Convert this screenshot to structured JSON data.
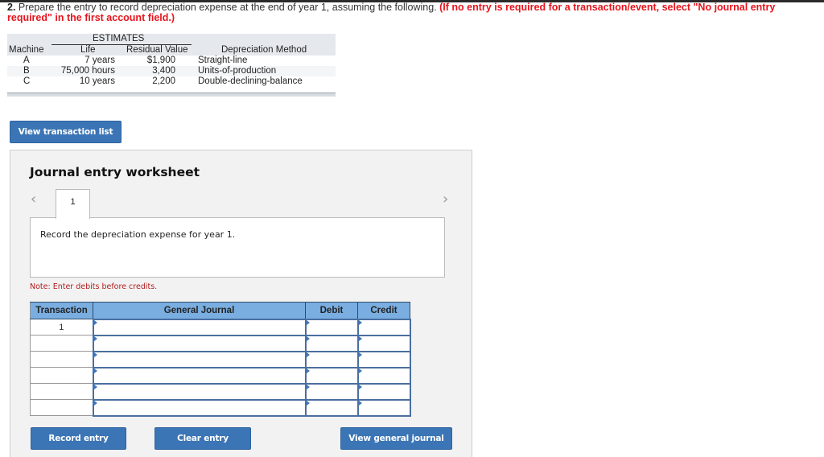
{
  "question": {
    "number": "2.",
    "text": " Prepare the entry to record depreciation expense at the end of year 1, assuming the following. ",
    "instruction": "(If no entry is required for a transaction/event, select \"No journal entry required\" in the first account field.)"
  },
  "estimates_table": {
    "group_header": "ESTIMATES",
    "headers": [
      "Machine",
      "Life",
      "Residual Value",
      "Depreciation Method"
    ],
    "rows": [
      {
        "machine": "A",
        "life": "7 years",
        "residual": "$1,900",
        "method": "Straight-line"
      },
      {
        "machine": "B",
        "life": "75,000 hours",
        "residual": "3,400",
        "method": "Units-of-production"
      },
      {
        "machine": "C",
        "life": "10 years",
        "residual": "2,200",
        "method": "Double-declining-balance"
      }
    ]
  },
  "buttons": {
    "view_transaction_list": "View transaction list",
    "record_entry": "Record entry",
    "clear_entry": "Clear entry",
    "view_general_journal": "View general journal"
  },
  "worksheet": {
    "title": "Journal entry worksheet",
    "prev_icon": "‹",
    "next_icon": "›",
    "tabs": [
      "1"
    ],
    "prompt": "Record the depreciation expense for year 1.",
    "note": "Note: Enter debits before credits.",
    "table": {
      "headers": [
        "Transaction",
        "General Journal",
        "Debit",
        "Credit"
      ],
      "rows": [
        {
          "transaction": "1",
          "account": "",
          "debit": "",
          "credit": ""
        },
        {
          "transaction": "",
          "account": "",
          "debit": "",
          "credit": ""
        },
        {
          "transaction": "",
          "account": "",
          "debit": "",
          "credit": ""
        },
        {
          "transaction": "",
          "account": "",
          "debit": "",
          "credit": ""
        },
        {
          "transaction": "",
          "account": "",
          "debit": "",
          "credit": ""
        },
        {
          "transaction": "",
          "account": "",
          "debit": "",
          "credit": ""
        }
      ]
    }
  },
  "colors": {
    "button": "#3b75b5",
    "instruction_red": "#e8141c",
    "header_blue": "#7aaee0",
    "note_red": "#b21e1e"
  }
}
